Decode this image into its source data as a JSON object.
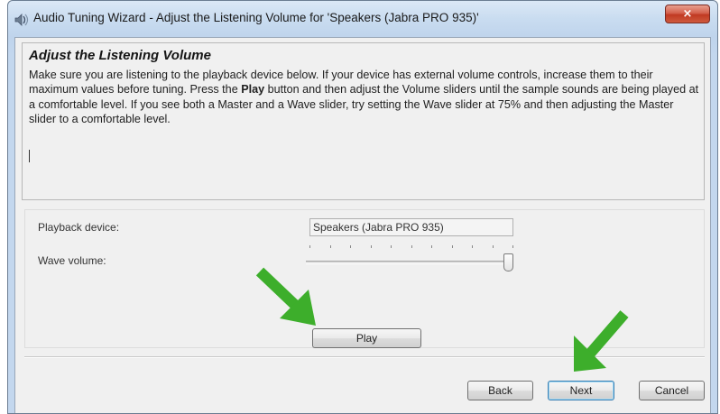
{
  "window": {
    "title": "Audio Tuning Wizard - Adjust the Listening Volume for 'Speakers (Jabra PRO 935)'",
    "close_label": "×",
    "app_icon": "speaker-wizard-icon",
    "close_icon": "close-icon"
  },
  "info": {
    "heading": "Adjust the Listening Volume",
    "body_before": "Make sure you are listening to the playback device below. If your device has external volume controls, increase them to their maximum values before tuning. Press the ",
    "body_bold": "Play",
    "body_after": " button and then adjust the Volume sliders until the sample sounds are being played at a comfortable level. If you see both a Master and a Wave slider, try setting the Wave slider at 75% and then adjusting the Master slider to a comfortable level."
  },
  "settings": {
    "device_label": "Playback device:",
    "device_value": "Speakers (Jabra PRO 935)",
    "wave_label": "Wave volume:",
    "wave_level": 1.0,
    "play_label": "Play"
  },
  "footer": {
    "back_label": "Back",
    "next_label": "Next",
    "cancel_label": "Cancel"
  },
  "colors": {
    "annotation_arrow": "#3dae2b",
    "title_bar": "#c3d7ee",
    "close_button": "#c03a22",
    "default_button_border": "#3c7fb1"
  },
  "annotations": [
    "arrow-pointing-play",
    "arrow-pointing-next"
  ]
}
